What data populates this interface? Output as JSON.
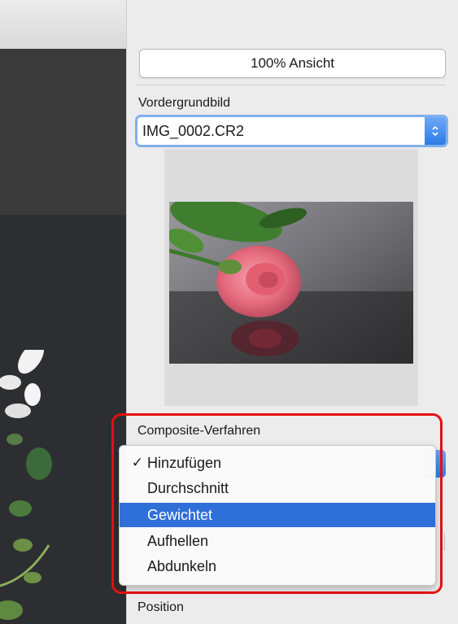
{
  "panel": {
    "view_button": "100% Ansicht",
    "foreground_label": "Vordergrundbild",
    "foreground_value": "IMG_0002.CR2",
    "composite_label": "Composite-Verfahren",
    "position_label": "Position"
  },
  "composite_menu": {
    "items": [
      {
        "label": "Hinzufügen",
        "checked": true
      },
      {
        "label": "Durchschnitt",
        "checked": false
      },
      {
        "label": "Gewichtet",
        "checked": false,
        "highlighted": true
      },
      {
        "label": "Aufhellen",
        "checked": false
      },
      {
        "label": "Abdunkeln",
        "checked": false
      }
    ],
    "check_glyph": "✓"
  },
  "colors": {
    "highlight": "#2f6fd8",
    "annotation": "#e31010"
  }
}
